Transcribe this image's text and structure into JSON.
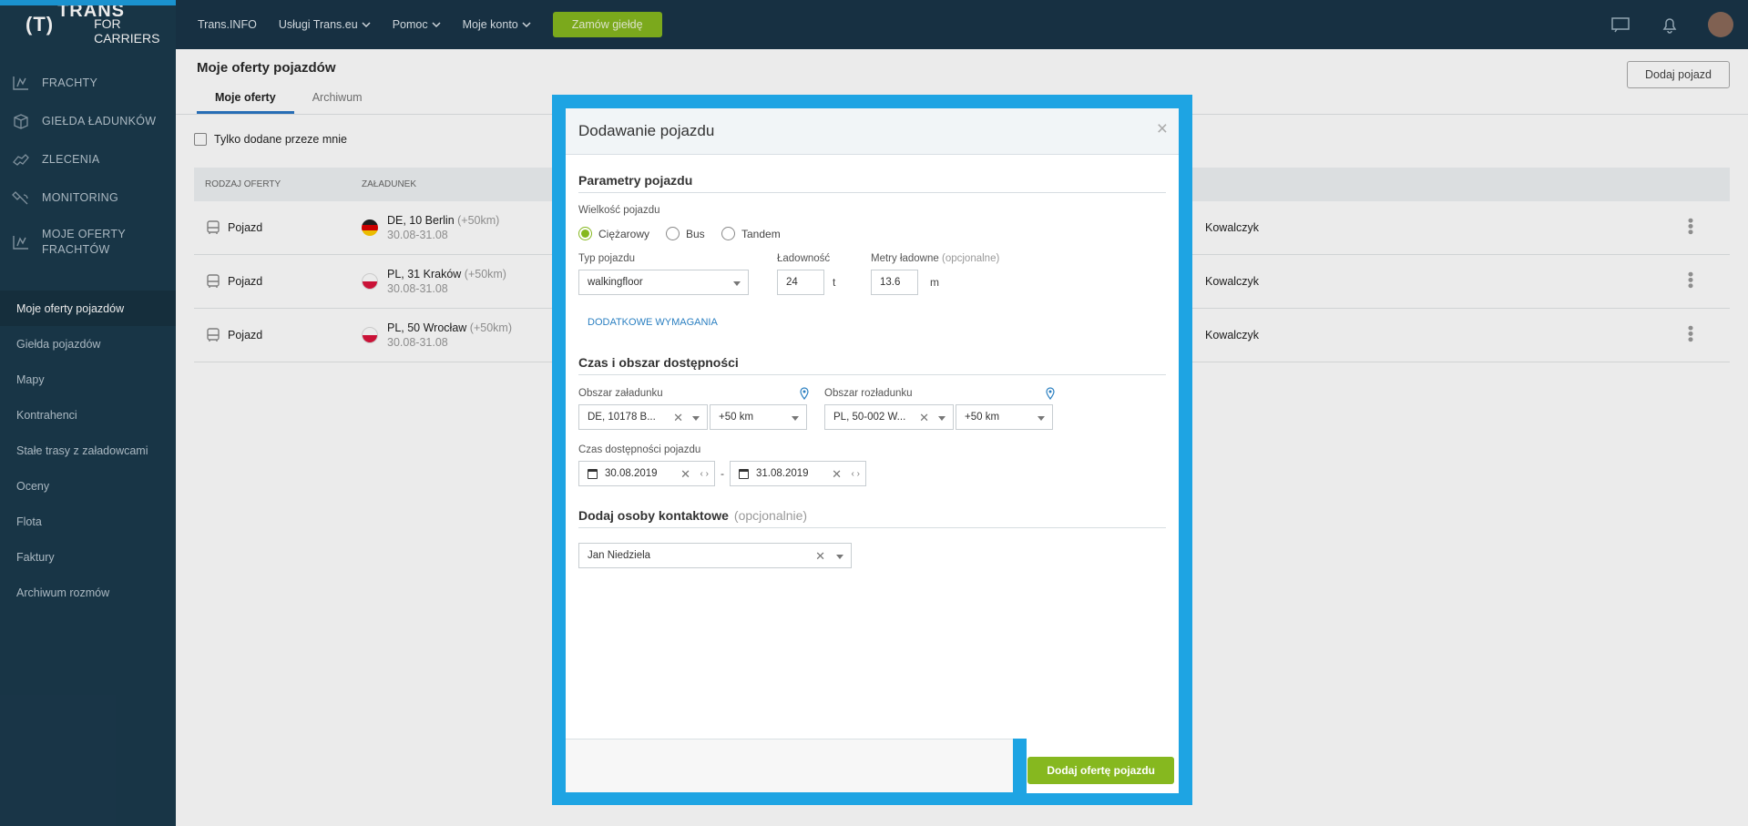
{
  "logo": {
    "mark": "(T)",
    "brand": "TRANS",
    "sub": "FOR CARRIERS"
  },
  "sidebar": {
    "main": [
      {
        "label": "FRACHTY",
        "icon": "freight-icon"
      },
      {
        "label": "GIEŁDA ŁADUNKÓW",
        "icon": "cargo-box-icon"
      },
      {
        "label": "ZLECENIA",
        "icon": "handshake-icon"
      },
      {
        "label": "MONITORING",
        "icon": "satellite-icon"
      },
      {
        "label": "MOJE OFERTY FRACHTÓW",
        "icon": "offers-icon"
      }
    ],
    "sub": [
      {
        "label": "Moje oferty pojazdów"
      },
      {
        "label": "Giełda pojazdów"
      },
      {
        "label": "Mapy"
      },
      {
        "label": "Kontrahenci"
      },
      {
        "label": "Stałe trasy z załadowcami"
      },
      {
        "label": "Oceny"
      },
      {
        "label": "Flota"
      },
      {
        "label": "Faktury"
      },
      {
        "label": "Archiwum rozmów"
      }
    ]
  },
  "topbar": {
    "links": [
      "Trans.INFO",
      "Usługi Trans.eu",
      "Pomoc",
      "Moje konto"
    ],
    "cta": "Zamów giełdę",
    "icons": [
      "chat-icon",
      "bell-icon",
      "user-avatar"
    ]
  },
  "page": {
    "title": "Moje oferty pojazdów",
    "tabs": [
      "Moje oferty",
      "Archiwum"
    ],
    "add_button": "Dodaj pojazd",
    "filter_label": "Tylko dodane przeze mnie",
    "columns": [
      "RODZAJ OFERTY",
      "ZAŁADUNEK"
    ],
    "rows": [
      {
        "type": "Pojazd",
        "flag": "de",
        "place": "DE, 10 Berlin",
        "radius": "(+50km)",
        "dates": "30.08-31.08",
        "person": "Kowalczyk"
      },
      {
        "type": "Pojazd",
        "flag": "pl",
        "place": "PL, 31 Kraków",
        "radius": "(+50km)",
        "dates": "30.08-31.08",
        "person": "Kowalczyk"
      },
      {
        "type": "Pojazd",
        "flag": "pl",
        "place": "PL, 50 Wrocław",
        "radius": "(+50km)",
        "dates": "30.08-31.08",
        "person": "Kowalczyk"
      }
    ]
  },
  "modal": {
    "title": "Dodawanie pojazdu",
    "close": "×",
    "section_params": "Parametry pojazdu",
    "size_label": "Wielkość pojazdu",
    "sizes": [
      "Ciężarowy",
      "Bus",
      "Tandem"
    ],
    "type_label": "Typ pojazdu",
    "type_value": "walkingfloor",
    "capacity_label": "Ładowność",
    "capacity_value": "24",
    "capacity_unit": "t",
    "meters_label": "Metry ładowne",
    "meters_optional": "(opcjonalne)",
    "meters_value": "13.6",
    "meters_unit": "m",
    "extra_link": "DODATKOWE WYMAGANIA",
    "section_time": "Czas i obszar dostępności",
    "load_area_label": "Obszar załadunku",
    "load_area_value": "DE, 10178 B...",
    "load_radius": "+50 km",
    "unload_area_label": "Obszar rozładunku",
    "unload_area_value": "PL, 50-002 W...",
    "unload_radius": "+50 km",
    "availability_label": "Czas dostępności pojazdu",
    "date_from": "30.08.2019",
    "date_sep": "-",
    "date_to": "31.08.2019",
    "section_contacts": "Dodaj osoby kontaktowe",
    "contacts_optional": "(opcjonalnie)",
    "contact_value": "Jan Niedziela",
    "submit": "Dodaj ofertę pojazdu"
  },
  "colors": {
    "accent_green": "#86b81f",
    "frame_blue": "#1ea4e3",
    "sidebar": "#1b3a4d"
  }
}
